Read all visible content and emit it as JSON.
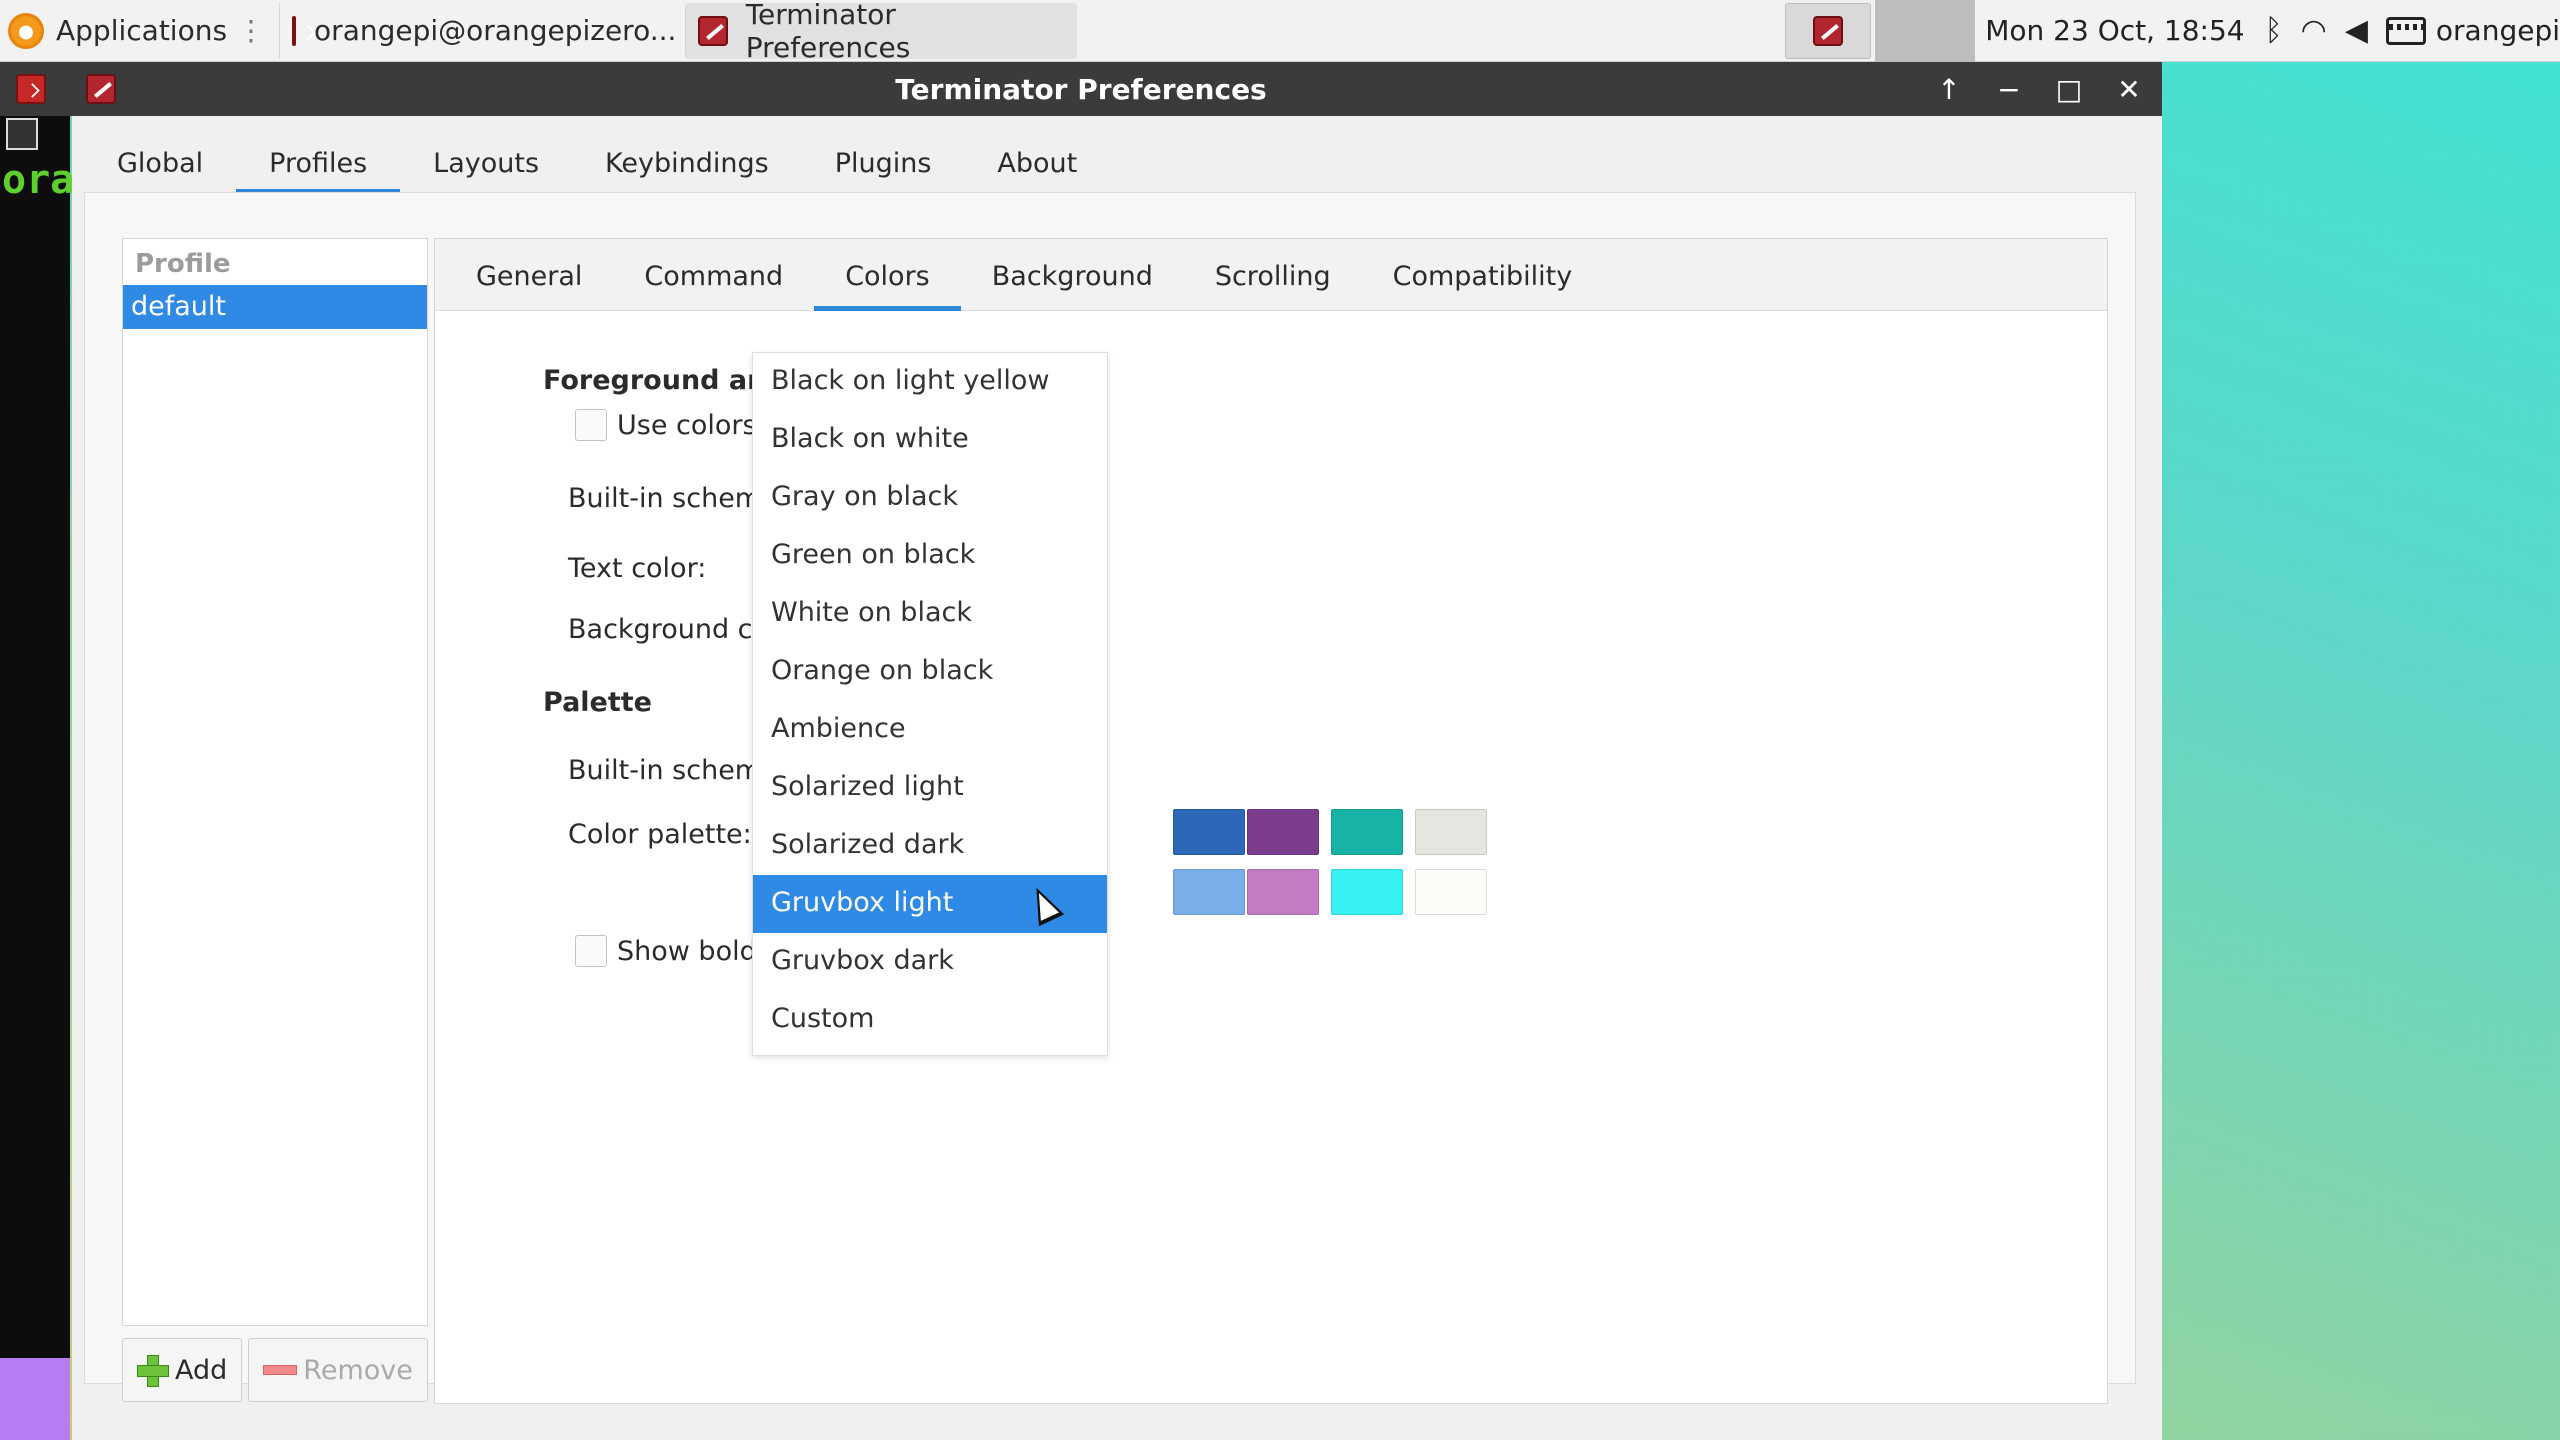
{
  "panel": {
    "applications_label": "Applications",
    "tasks": [
      "orangepi@orangepizero...",
      "Terminator Preferences"
    ],
    "clock": "Mon 23 Oct, 18:54",
    "user": "orangepi",
    "icons": [
      "orangepi-logo-icon",
      "terminal-icon",
      "preferences-icon",
      "bluetooth-icon",
      "wifi-icon",
      "volume-icon",
      "keyboard-icon"
    ]
  },
  "terminal_strip": {
    "prompt_text": "ora"
  },
  "window": {
    "title": "Terminator Preferences",
    "main_tabs": [
      "Global",
      "Profiles",
      "Layouts",
      "Keybindings",
      "Plugins",
      "About"
    ],
    "active_main_tab": "Profiles"
  },
  "profiles": {
    "header": "Profile",
    "items": [
      "default"
    ],
    "selected": "default",
    "add_label": "Add",
    "remove_label": "Remove"
  },
  "sub_tabs": [
    "General",
    "Command",
    "Colors",
    "Background",
    "Scrolling",
    "Compatibility"
  ],
  "active_sub_tab": "Colors",
  "colors": {
    "fg_bg_title": "Foreground and Ba",
    "use_colors_label": "Use colors from",
    "builtin_schemes_label": "Built-in schemes:",
    "text_color_label": "Text color:",
    "background_color_label": "Background color:",
    "palette_title": "Palette",
    "palette_builtin_label": "Built-in schemes:",
    "color_palette_label": "Color palette:",
    "show_bold_label": "Show bold text i",
    "swatches_row1": [
      "#2b68b8",
      "#7b3c8c",
      "#16b3a6",
      "#e4e7e0"
    ],
    "swatches_row2": [
      "#7aaee8",
      "#c27cc4",
      "#38f2f2",
      "#fbfbf8"
    ]
  },
  "dropdown": {
    "items": [
      "Black on light yellow",
      "Black on white",
      "Gray on black",
      "Green on black",
      "White on black",
      "Orange on black",
      "Ambience",
      "Solarized light",
      "Solarized dark",
      "Gruvbox light",
      "Gruvbox dark",
      "Custom"
    ],
    "highlighted": "Gruvbox light",
    "highlight_color": "#2f8ae6"
  },
  "accent_color": "#2f86d8"
}
